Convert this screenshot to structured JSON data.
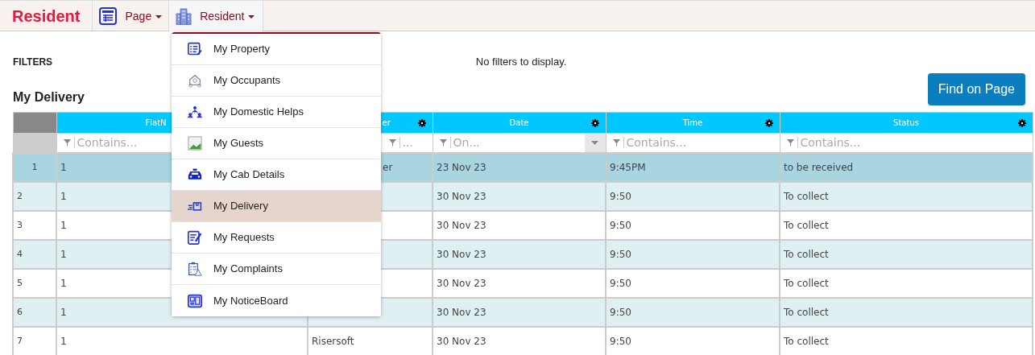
{
  "navbar": {
    "brand": "Resident",
    "menus": [
      {
        "label": "Page",
        "open": false
      },
      {
        "label": "Resident",
        "open": true
      }
    ]
  },
  "dropdown": {
    "items": [
      {
        "label": "My Property",
        "selected": false
      },
      {
        "label": "My Occupants",
        "selected": false
      },
      {
        "label": "My Domestic Helps",
        "selected": false
      },
      {
        "label": "My Guests",
        "selected": false
      },
      {
        "label": "My Cab Details",
        "selected": false
      },
      {
        "label": "My Delivery",
        "selected": true
      },
      {
        "label": "My Requests",
        "selected": false
      },
      {
        "label": "My Complaints",
        "selected": false
      },
      {
        "label": "My NoticeBoard",
        "selected": false
      }
    ]
  },
  "filters": {
    "title": "FILTERS",
    "message": "No filters to display."
  },
  "section_title": "My Delivery",
  "find_button": "Find on Page",
  "table": {
    "columns": [
      {
        "label": "FlatN",
        "filter": "Contains..."
      },
      {
        "label": "er",
        "filter": "..."
      },
      {
        "label": "Date",
        "filter": "On..."
      },
      {
        "label": "Time",
        "filter": "Contains..."
      },
      {
        "label": "Status",
        "filter": "Contains..."
      }
    ],
    "rows": [
      {
        "number": "1",
        "selected": true,
        "cells": [
          "1",
          "er",
          "23 Nov 23",
          "9:45PM",
          "to be received"
        ]
      },
      {
        "number": "2",
        "selected": false,
        "cells": [
          "1",
          "",
          "30 Nov 23",
          "9:50",
          "To collect"
        ]
      },
      {
        "number": "3",
        "selected": false,
        "cells": [
          "1",
          "",
          "30 Nov 23",
          "9:50",
          "To collect"
        ]
      },
      {
        "number": "4",
        "selected": false,
        "cells": [
          "1",
          "",
          "30 Nov 23",
          "9:50",
          "To collect"
        ]
      },
      {
        "number": "5",
        "selected": false,
        "cells": [
          "1",
          "",
          "30 Nov 23",
          "9:50",
          "To collect"
        ]
      },
      {
        "number": "6",
        "selected": false,
        "cells": [
          "1",
          "",
          "30 Nov 23",
          "9:50",
          "To collect"
        ]
      },
      {
        "number": "7",
        "selected": false,
        "cells": [
          "1",
          "Risersoft",
          "30 Nov 23",
          "9:50",
          "To collect"
        ]
      }
    ]
  }
}
